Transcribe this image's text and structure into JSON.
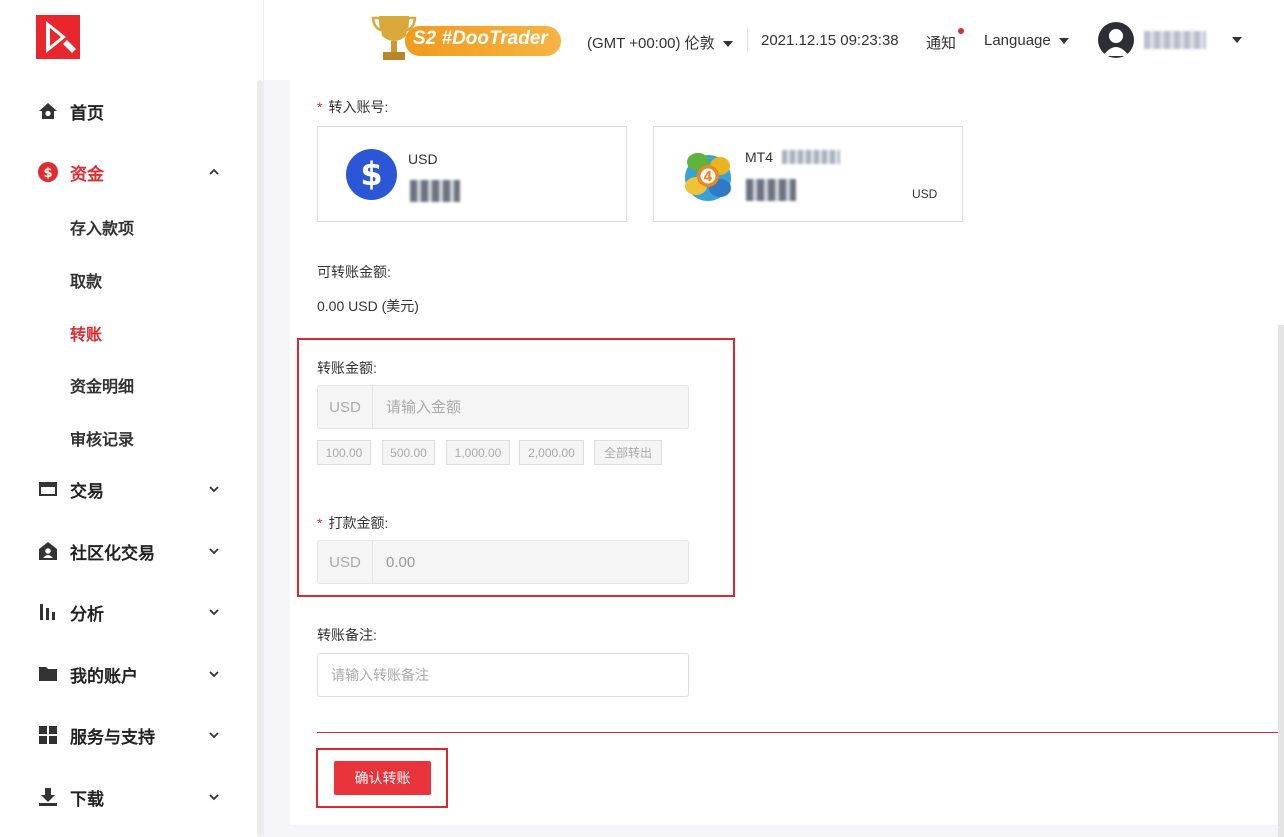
{
  "header": {
    "badge_text": "S2 #DooTrader",
    "timezone": "(GMT +00:00) 伦敦",
    "datetime": "2021.12.15 09:23:38",
    "notifications": "通知",
    "language": "Language"
  },
  "sidebar": {
    "items": [
      {
        "label": "首页"
      },
      {
        "label": "资金"
      },
      {
        "label": "交易"
      },
      {
        "label": "社区化交易"
      },
      {
        "label": "分析"
      },
      {
        "label": "我的账户"
      },
      {
        "label": "服务与支持"
      },
      {
        "label": "下载"
      }
    ],
    "funds_sub": [
      {
        "label": "存入款项"
      },
      {
        "label": "取款"
      },
      {
        "label": "转账"
      },
      {
        "label": "资金明细"
      },
      {
        "label": "审核记录"
      }
    ]
  },
  "form": {
    "to_account_label": "转入账号:",
    "card_usd": {
      "name": "USD"
    },
    "card_mt4": {
      "name": "MT4",
      "currency": "USD"
    },
    "available_label": "可转账金额:",
    "available_value": "0.00 USD (美元)",
    "amount_label": "转账金额:",
    "amount_prefix": "USD",
    "amount_placeholder": "请输入金额",
    "quick_amounts": [
      "100.00",
      "500.00",
      "1,000.00",
      "2,000.00",
      "全部转出"
    ],
    "payment_label": "打款金额:",
    "payment_prefix": "USD",
    "payment_value": "0.00",
    "remark_label": "转账备注:",
    "remark_placeholder": "请输入转账备注",
    "confirm_label": "确认转账"
  },
  "colors": {
    "brand_red": "#e02b2f",
    "usd_blue": "#2b56d6"
  }
}
